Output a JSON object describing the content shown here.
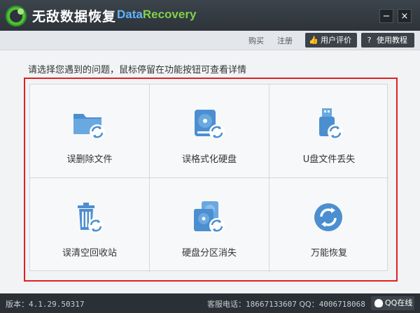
{
  "app": {
    "title_cn": "无敌数据恢复",
    "title_en_part1": "Data",
    "title_en_part2": "Recovery"
  },
  "window_controls": {
    "minimize": "−",
    "close": "×"
  },
  "header": {
    "buy_label": "购买",
    "register_label": "注册",
    "review_label": "用户评价",
    "tutorial_label": "使用教程"
  },
  "main": {
    "instruction": "请选择您遇到的问题，鼠标停留在功能按钮可查看详情",
    "options": [
      {
        "label": "误删除文件",
        "icon": "folder-recover-icon"
      },
      {
        "label": "误格式化硬盘",
        "icon": "disk-format-recover-icon"
      },
      {
        "label": "U盘文件丢失",
        "icon": "usb-recover-icon"
      },
      {
        "label": "误清空回收站",
        "icon": "recycle-bin-recover-icon"
      },
      {
        "label": "硬盘分区消失",
        "icon": "partition-recover-icon"
      },
      {
        "label": "万能恢复",
        "icon": "universal-recover-icon"
      }
    ]
  },
  "status": {
    "version_label": "版本：",
    "version": "4.1.29.50317",
    "hotline_label": "客服电话：",
    "hotline": "18667133607",
    "qq_label": "QQ：",
    "qq": "4006718068",
    "qq_online": "QQ在线"
  },
  "colors": {
    "icon_blue": "#4b8fd0",
    "frame_red": "#e02020",
    "titlebar": "#2d3339",
    "brand_green": "#7fd14a",
    "brand_blue": "#5fb4ff"
  }
}
